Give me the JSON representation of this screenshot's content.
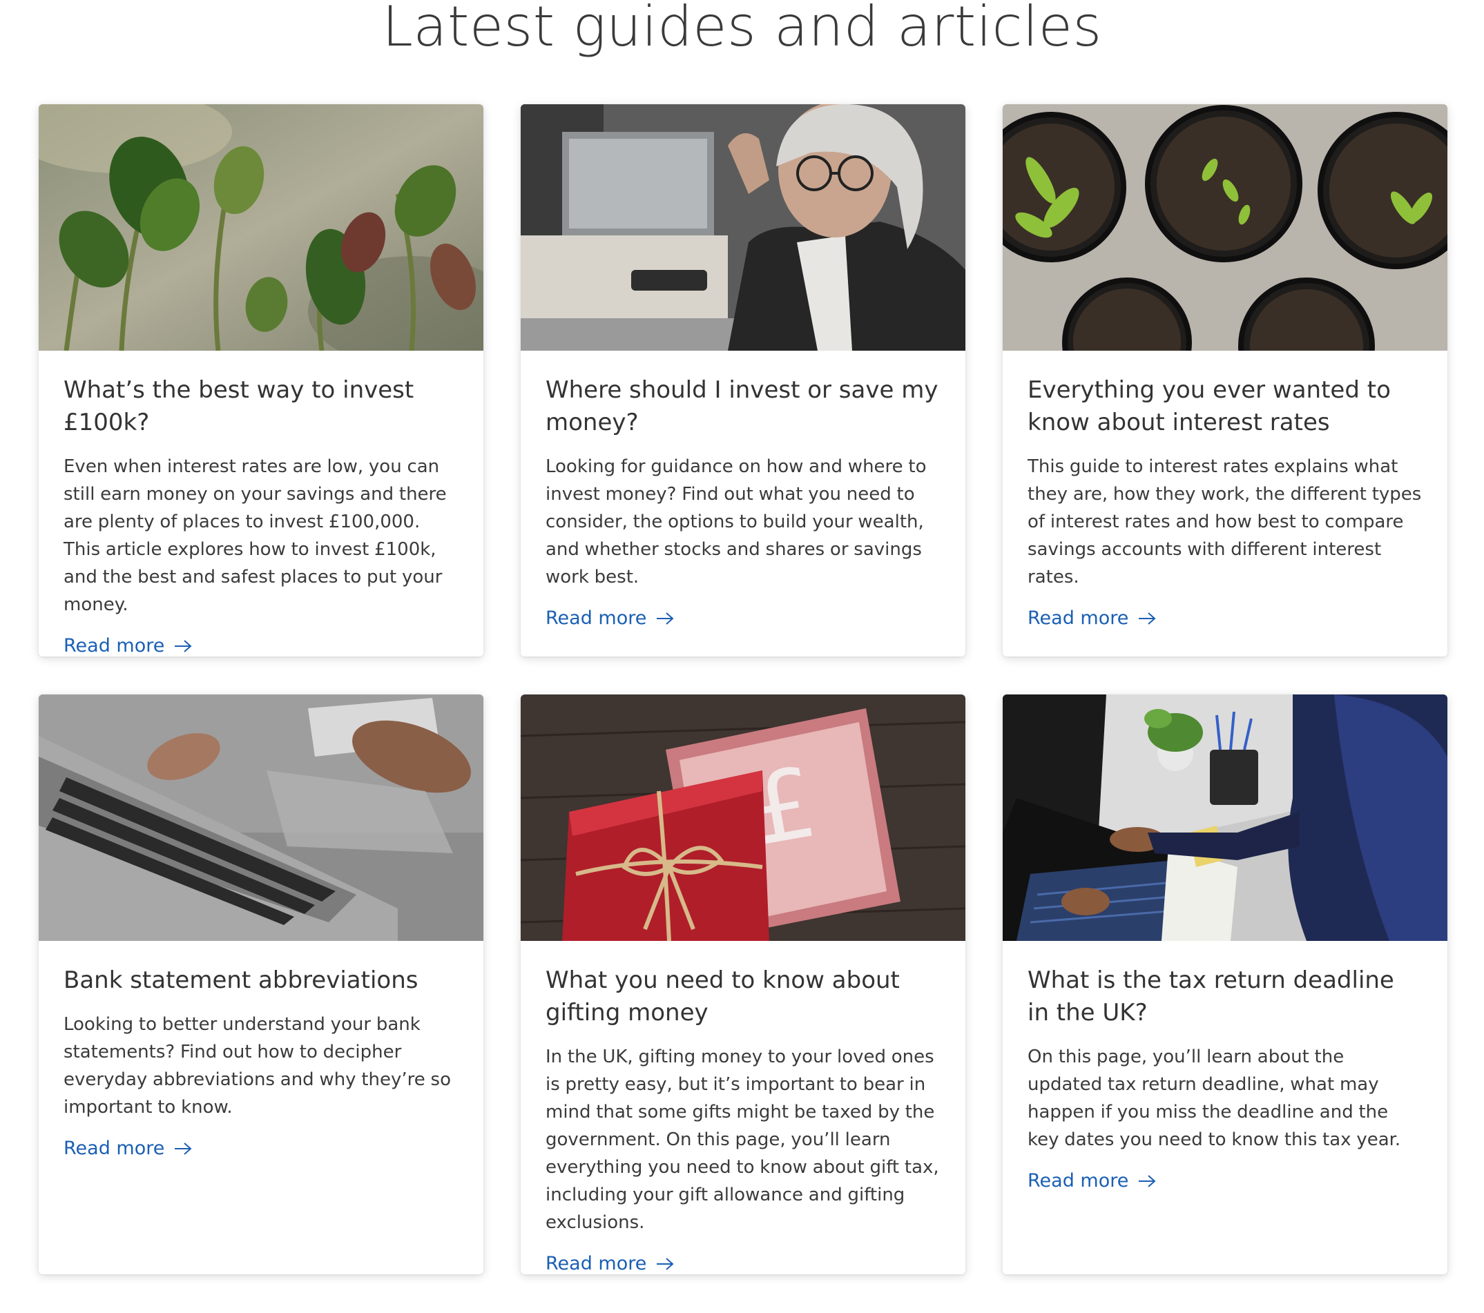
{
  "section": {
    "title": "Latest guides and articles"
  },
  "articles": [
    {
      "title": "What’s the best way to invest £100k?",
      "text": "Even when interest rates are low, you can still earn money on your savings and there are plenty of places to invest £100,000. This art­icle explores how to invest £100k, and the best and safest places to put your money.",
      "link": "Read more",
      "image": "seedlings-photo"
    },
    {
      "title": "Where should I invest or save my money?",
      "text": "Looking for guidance on how and where to invest money? Find out what you need to consider, the options to build your wealth, and whether stocks and shares or savings work best.",
      "link": "Read more",
      "image": "woman-with-glasses-photo"
    },
    {
      "title": "Everything you ever wanted to know about interest rates",
      "text": "This guide to interest rates explains what they are, how they work, the different types of interest rates and how best to compare savings accounts with different interest rates.",
      "link": "Read more",
      "image": "plant-pots-photo"
    },
    {
      "title": "Bank statement abbreviations",
      "text": "Looking to better understand your bank statements? Find out how to decipher every­day abbreviations and why they’re so import­ant to know.",
      "link": "Read more",
      "image": "laptop-card-photo"
    },
    {
      "title": "What you need to know about gifting money",
      "text": "In the UK, gifting money to your loved ones is pretty easy, but it’s important to bear in mind that some gifts might be taxed by the govern­ment. On this page, you’ll learn everything you need to know about gift tax, including your gift allowance and gifting exclusions.",
      "link": "Read more",
      "image": "gift-box-pound-photo"
    },
    {
      "title": "What is the tax return deadline in the UK?",
      "text": "On this page, you’ll learn about the updated tax return deadline, what may happen if you miss the deadline and the key dates you need to know this tax year.",
      "link": "Read more",
      "image": "person-at-laptop-photo"
    }
  ],
  "colors": {
    "link": "#1a5fb4",
    "title": "#3a3a3a",
    "card_background": "#ffffff"
  },
  "icons": {
    "read_more": "arrow-right-icon"
  }
}
